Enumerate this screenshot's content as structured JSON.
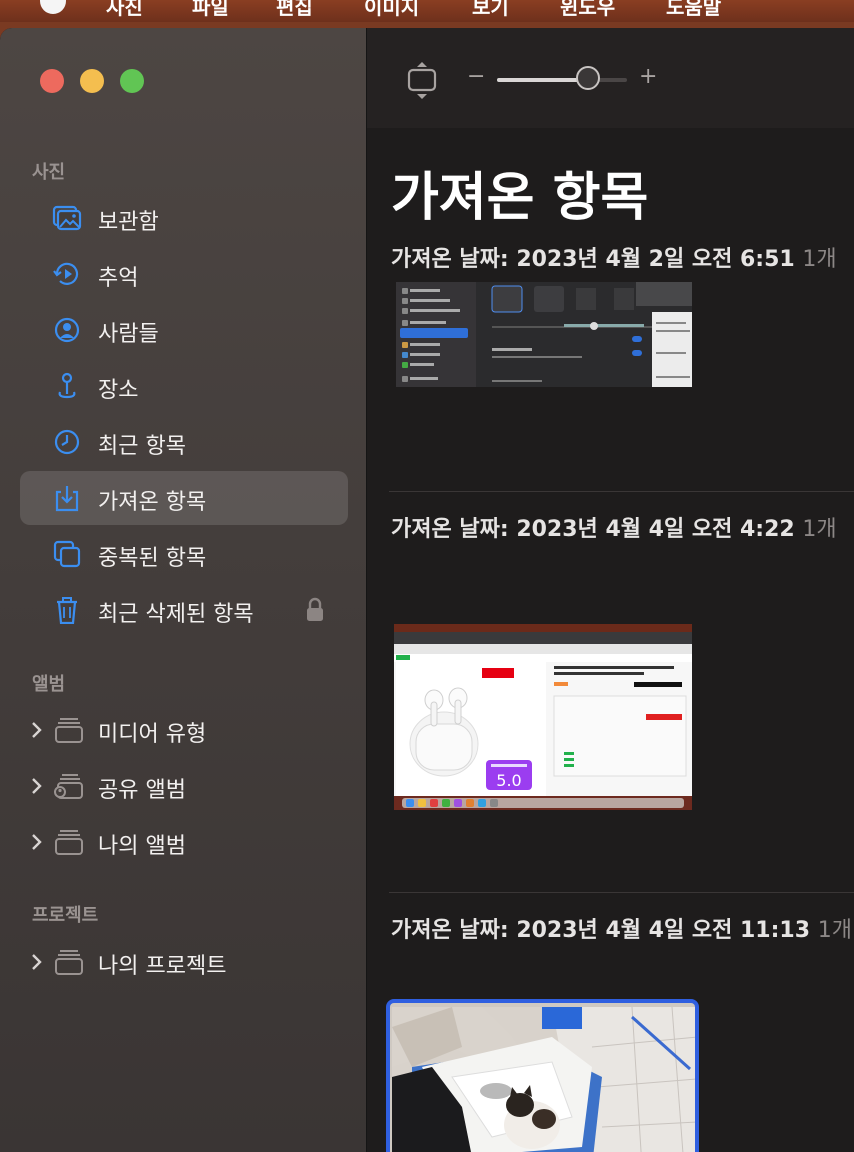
{
  "menubar": {
    "items": [
      "사진",
      "파일",
      "편집",
      "이미지",
      "보기",
      "윈도우",
      "도움말"
    ]
  },
  "sidebar": {
    "sections": [
      {
        "title": "사진"
      },
      {
        "title": "앨범"
      },
      {
        "title": "프로젝트"
      }
    ],
    "photos_items": [
      {
        "label": "보관함",
        "icon": "library-icon"
      },
      {
        "label": "추억",
        "icon": "memories-icon"
      },
      {
        "label": "사람들",
        "icon": "people-icon"
      },
      {
        "label": "장소",
        "icon": "places-pin-icon"
      },
      {
        "label": "최근 항목",
        "icon": "clock-icon"
      },
      {
        "label": "가져온 항목",
        "icon": "import-icon",
        "selected": true
      },
      {
        "label": "중복된 항목",
        "icon": "duplicates-icon"
      },
      {
        "label": "최근 삭제된 항목",
        "icon": "trash-icon",
        "locked": true
      }
    ],
    "album_items": [
      {
        "label": "미디어 유형",
        "icon": "folder-stack-icon"
      },
      {
        "label": "공유 앨범",
        "icon": "shared-album-icon"
      },
      {
        "label": "나의 앨범",
        "icon": "folder-stack-icon"
      }
    ],
    "project_items": [
      {
        "label": "나의 프로젝트",
        "icon": "folder-stack-icon"
      }
    ]
  },
  "toolbar": {
    "zoom_minus": "−",
    "zoom_plus": "+",
    "zoom_level": 0.7
  },
  "main": {
    "title": "가져온 항목",
    "groups": [
      {
        "header": "가져온 날짜: 2023년 4월 2일 오전 6:51",
        "count": "1개"
      },
      {
        "header": "가져온 날짜: 2023년 4월 4일 오전 4:22",
        "count": "1개"
      },
      {
        "header": "가져온 날짜: 2023년 4월 4일 오전 11:13",
        "count": "1개"
      }
    ]
  },
  "colors": {
    "accent": "#3b8ef0",
    "selection_border": "#2f5fe0",
    "sidebar_bg": "#4a4340",
    "content_bg": "#1e1c1c"
  }
}
